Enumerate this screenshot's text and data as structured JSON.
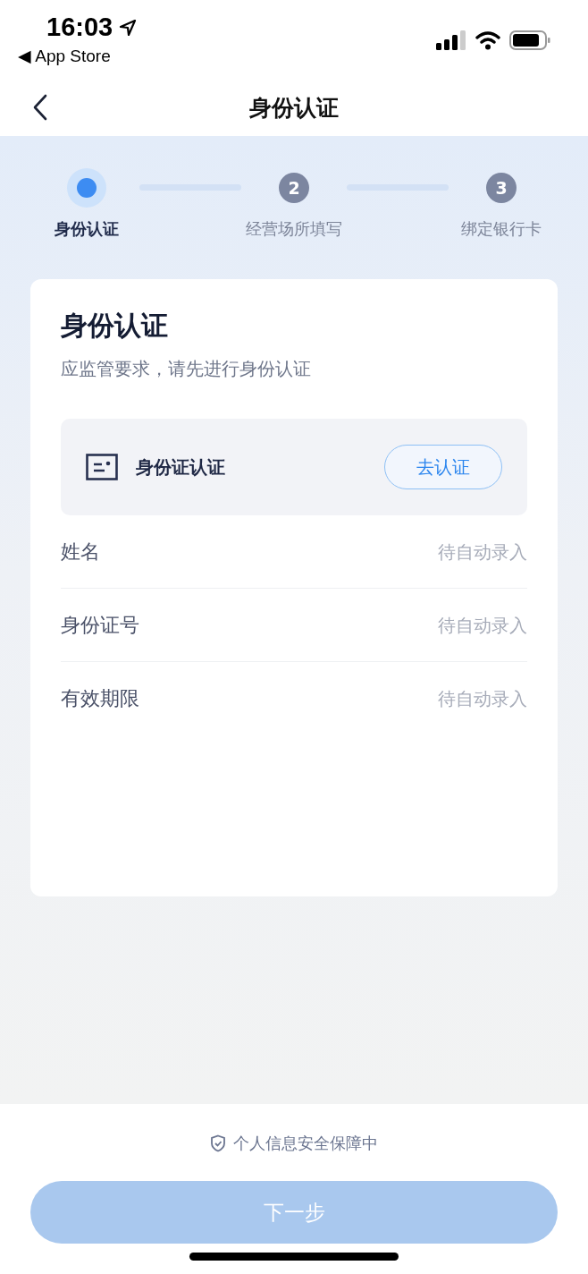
{
  "status_bar": {
    "time": "16:03",
    "back_app": "◀ App Store"
  },
  "nav": {
    "title": "身份认证"
  },
  "steps": [
    {
      "label": "身份认证",
      "current": true
    },
    {
      "label": "经营场所填写",
      "number": "2",
      "current": false
    },
    {
      "label": "绑定银行卡",
      "number": "3",
      "current": false
    }
  ],
  "card": {
    "title": "身份认证",
    "subtitle": "应监管要求，请先进行身份认证",
    "id_card": {
      "label": "身份证认证",
      "button": "去认证"
    },
    "fields": [
      {
        "label": "姓名",
        "placeholder": "待自动录入"
      },
      {
        "label": "身份证号",
        "placeholder": "待自动录入"
      },
      {
        "label": "有效期限",
        "placeholder": "待自动录入"
      }
    ]
  },
  "footer": {
    "notice": "个人信息安全保障中",
    "next_button": {
      "label": "下一步",
      "disabled": true
    }
  }
}
